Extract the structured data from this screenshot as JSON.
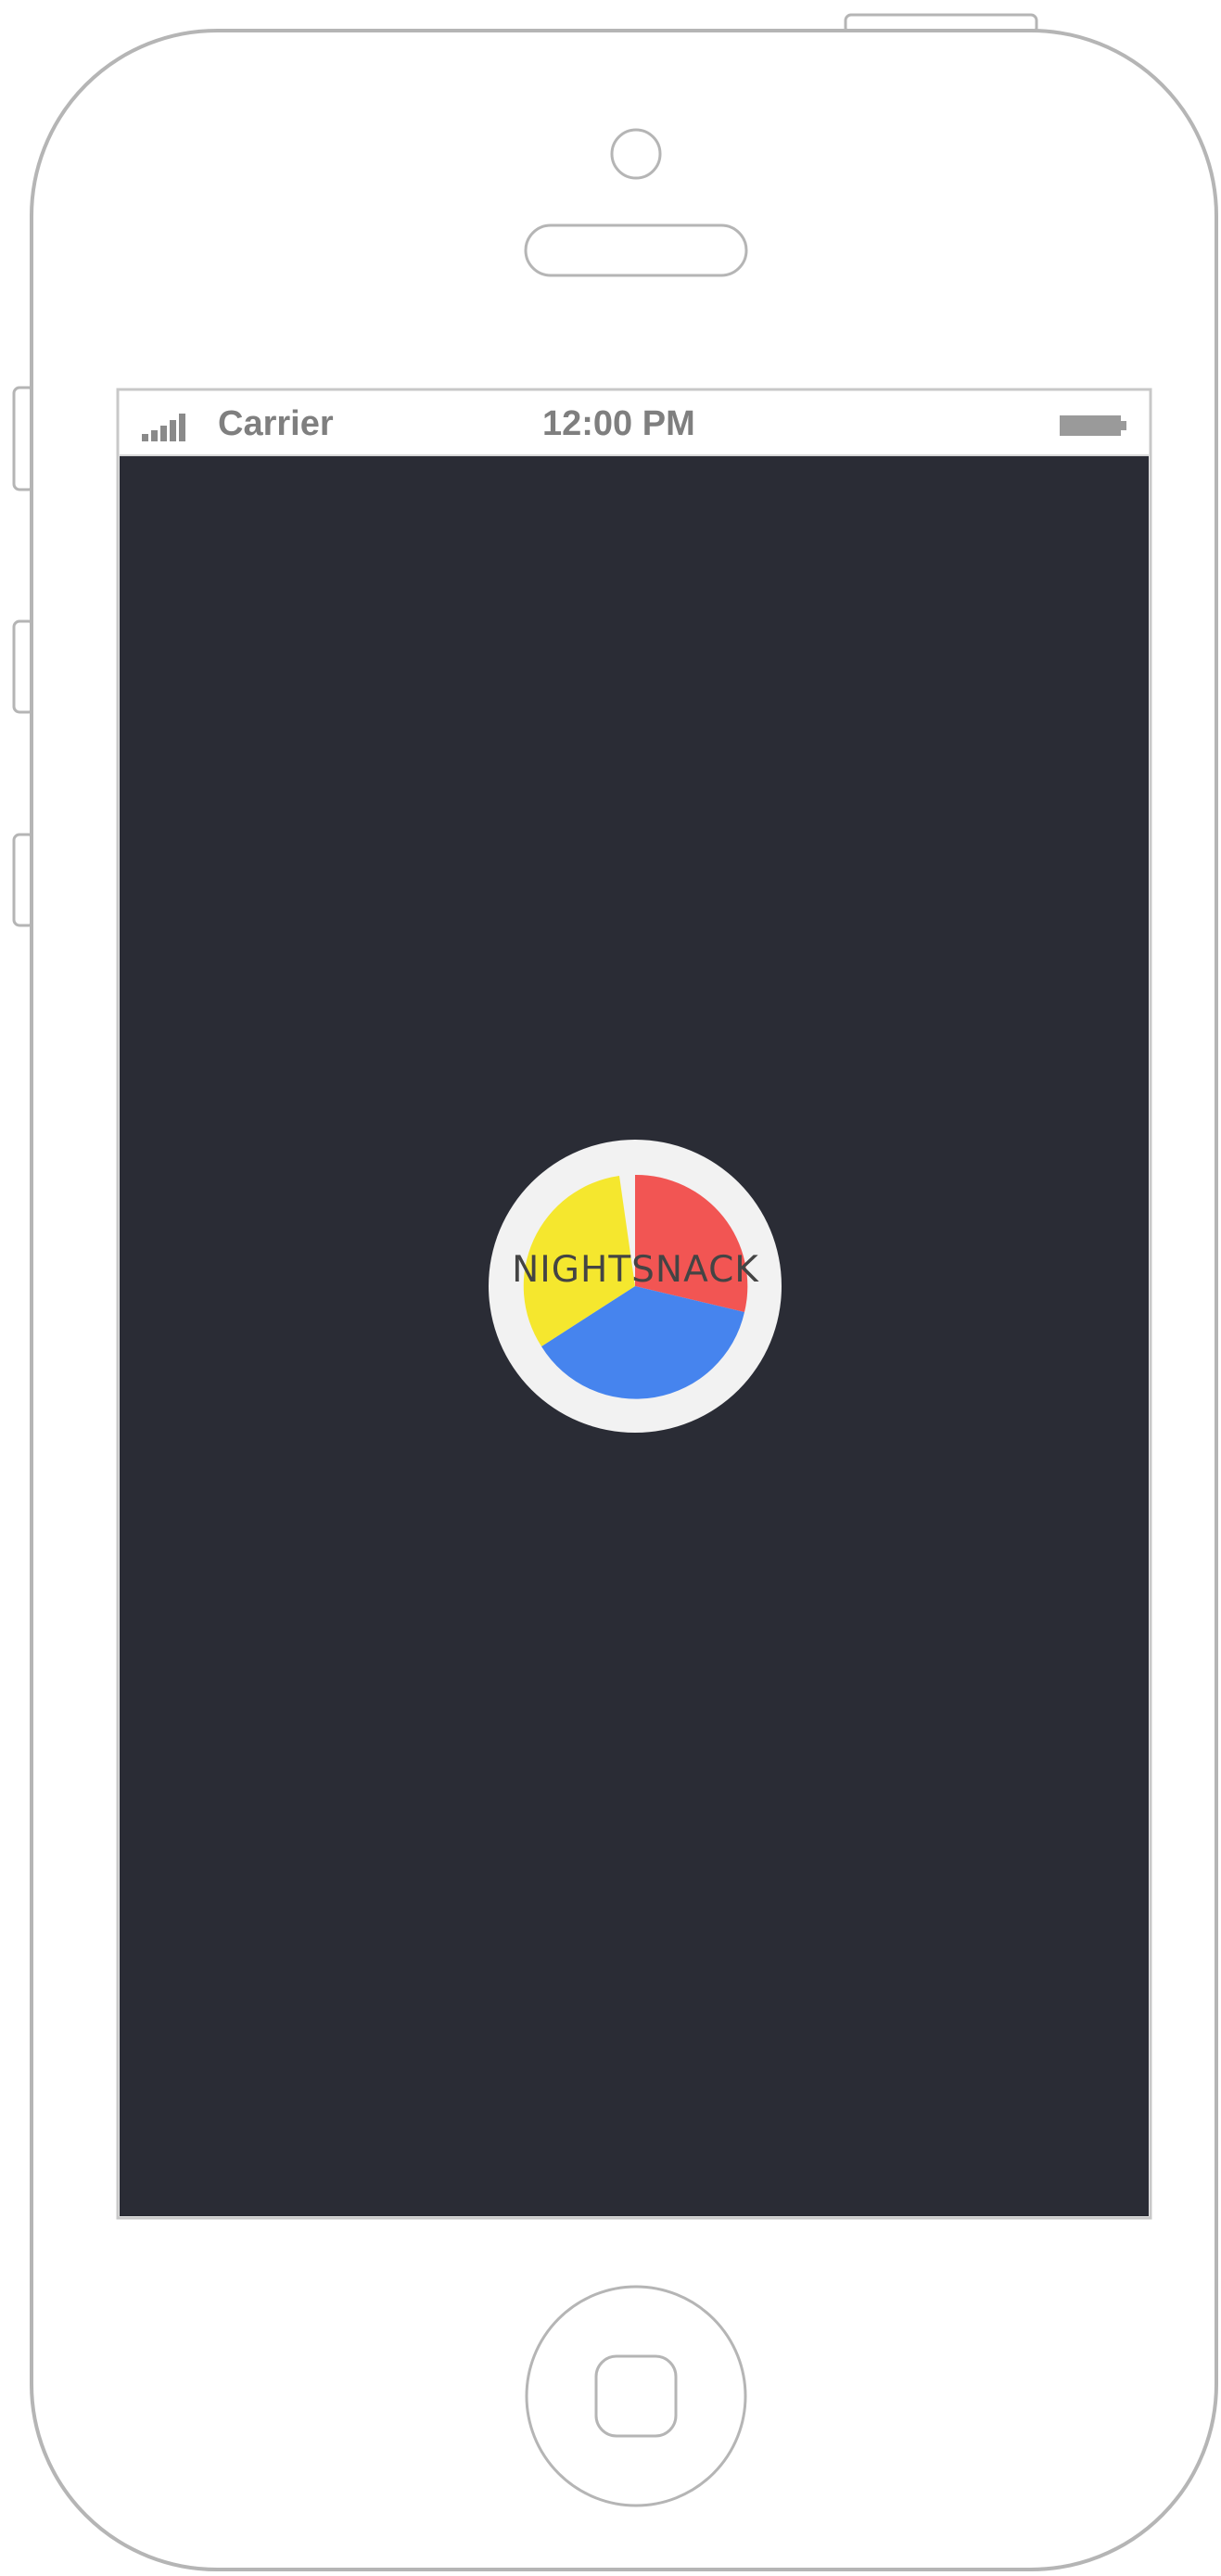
{
  "status_bar": {
    "carrier": "Carrier",
    "time": "12:00 PM"
  },
  "splash": {
    "logo_text": "NIGHTSNACK"
  },
  "icons": {
    "signal": "signal-strength-icon",
    "battery": "battery-icon",
    "home": "home-button-icon"
  },
  "colors": {
    "screen_background": "#2a2c35",
    "logo_red": "#f25553",
    "logo_yellow": "#f5e72e",
    "logo_blue": "#4684ee",
    "logo_ring": "#f2f2f2"
  }
}
